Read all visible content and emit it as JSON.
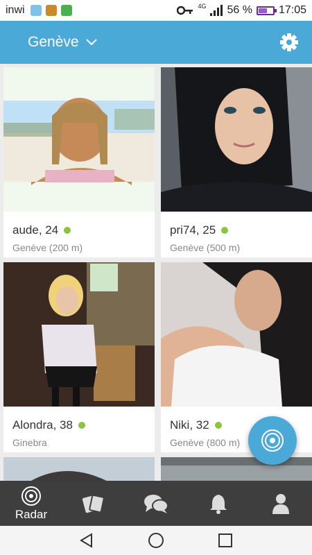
{
  "status_bar": {
    "carrier": "inwi",
    "network": "4G",
    "battery": "56 %",
    "battery_level": 0.56,
    "time": "17:05",
    "icons": [
      "app-notification-icon",
      "key-icon",
      "signal-icon",
      "battery-icon"
    ]
  },
  "app_bar": {
    "city": "Genève",
    "icons": [
      "chevron-down-icon",
      "gear-icon"
    ]
  },
  "profiles": [
    {
      "name_age": "aude, 24",
      "location": "Genève (200 m)",
      "online": true
    },
    {
      "name_age": "pri74, 25",
      "location": "Genève (500 m)",
      "online": true
    },
    {
      "name_age": "Alondra, 38",
      "location": "Ginebra",
      "online": true
    },
    {
      "name_age": "Niki, 32",
      "location": "Genève (800 m)",
      "online": true
    }
  ],
  "bottom_nav": {
    "items": [
      {
        "label": "Radar",
        "icon": "radar-icon",
        "active": true
      },
      {
        "label": "",
        "icon": "cards-icon"
      },
      {
        "label": "",
        "icon": "chat-icon"
      },
      {
        "label": "",
        "icon": "bell-icon"
      },
      {
        "label": "",
        "icon": "user-icon"
      }
    ]
  },
  "fab": {
    "icon": "radar-icon"
  },
  "system_nav": {
    "icons": [
      "back-icon",
      "home-icon",
      "recents-icon"
    ]
  },
  "colors": {
    "primary": "#4aa9d6",
    "online": "#8bc53f",
    "nav_bg": "#3e3e3e"
  }
}
